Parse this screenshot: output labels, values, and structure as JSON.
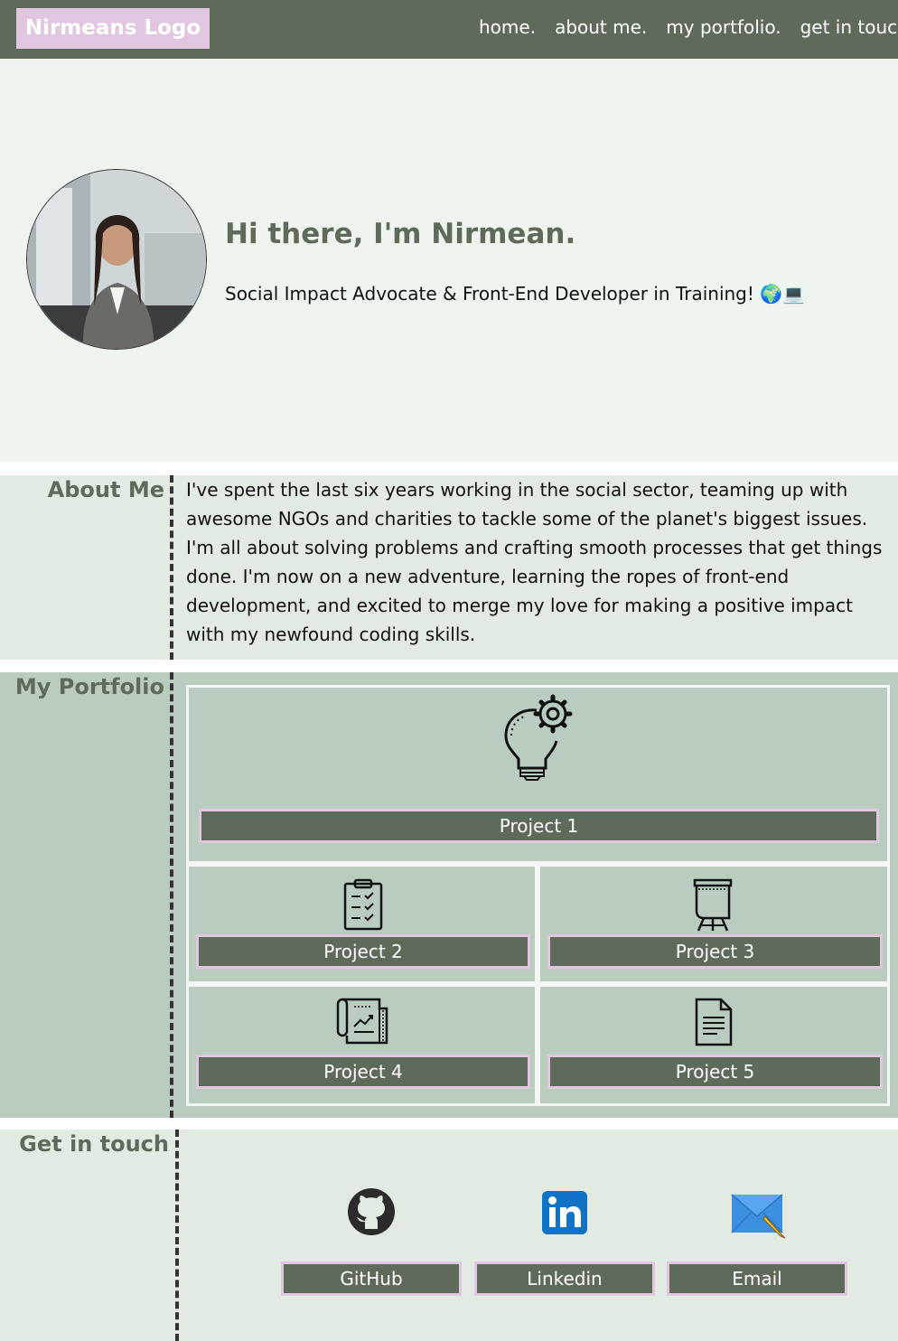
{
  "nav": {
    "logo": "Nirmeans Logo",
    "links": [
      "home.",
      "about me.",
      "my portfolio.",
      "get in touch."
    ]
  },
  "hero": {
    "title": "Hi there, I'm Nirmean.",
    "subtitle": "Social Impact Advocate & Front-End Developer in Training! 🌍💻"
  },
  "about": {
    "heading": "About Me",
    "text": "I've spent the last six years working in the social sector, teaming up with awesome NGOs and charities to tackle some of the planet's biggest issues. I'm all about solving problems and crafting smooth processes that get things done. I'm now on a new adventure, learning the ropes of front-end development, and excited to merge my love for making a positive impact with my newfound coding skills."
  },
  "portfolio": {
    "heading": "My Portfolio",
    "projects": [
      {
        "label": "Project 1",
        "icon": "lightbulb-gear-icon"
      },
      {
        "label": "Project 2",
        "icon": "clipboard-checklist-icon"
      },
      {
        "label": "Project 3",
        "icon": "flipchart-easel-icon"
      },
      {
        "label": "Project 4",
        "icon": "chart-scroll-icon"
      },
      {
        "label": "Project 5",
        "icon": "document-icon"
      }
    ]
  },
  "contact": {
    "heading": "Get in touch",
    "links": [
      {
        "label": "GitHub",
        "icon": "github-icon"
      },
      {
        "label": "Linkedin",
        "icon": "linkedin-icon"
      },
      {
        "label": "Email",
        "icon": "envelope-icon"
      }
    ]
  },
  "colors": {
    "nav_bg": "#5e6b5b",
    "logo_bg": "#e0c7df",
    "hero_bg": "#eef5ee",
    "section_light": "#e1ebe1",
    "section_portfolio": "#b9ccbe",
    "heading": "#5e6b5b",
    "button_border": "#e0c7df"
  }
}
